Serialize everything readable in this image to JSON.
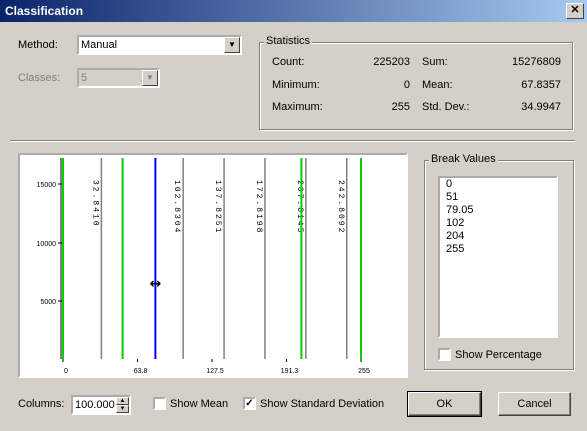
{
  "window": {
    "title": "Classification",
    "close_glyph": "✕"
  },
  "method": {
    "label": "Method:",
    "value": "Manual"
  },
  "classes": {
    "label": "Classes:",
    "value": "5"
  },
  "statistics": {
    "title": "Statistics",
    "count_label": "Count:",
    "count": "225203",
    "min_label": "Minimum:",
    "min": "0",
    "max_label": "Maximum:",
    "max": "255",
    "sum_label": "Sum:",
    "sum": "15276809",
    "mean_label": "Mean:",
    "mean": "67.8357",
    "std_label": "Std. Dev.:",
    "std": "34.9947"
  },
  "chart_data": {
    "type": "histogram",
    "y_ticks": [
      "15000",
      "10000",
      "5000"
    ],
    "x_ticks": [
      "0",
      "63.8",
      "127.5",
      "191.3",
      "255"
    ],
    "xlim": [
      0,
      255
    ],
    "gray_lines": [
      {
        "x": 32.841,
        "label": "32.8410"
      },
      {
        "x": 102.8304,
        "label": "102.8304"
      },
      {
        "x": 137.8251,
        "label": "137.8251"
      },
      {
        "x": 172.8198,
        "label": "172.8198"
      },
      {
        "x": 207.8145,
        "label": "207.8145"
      },
      {
        "x": 242.8092,
        "label": "242.8092"
      }
    ],
    "green_lines": [
      0,
      51,
      204,
      255
    ],
    "selected_line": 79.05,
    "colors": {
      "gray": "#808080",
      "green": "#00d000",
      "blue": "#0000ff"
    },
    "cursor_glyph": "↔"
  },
  "break_values": {
    "title": "Break Values",
    "values": [
      "0",
      "51",
      "79.05",
      "102",
      "204",
      "255"
    ]
  },
  "show_percentage": {
    "label": "Show Percentage",
    "checked": false
  },
  "columns": {
    "label": "Columns:",
    "value": "100.000"
  },
  "show_mean": {
    "label": "Show Mean",
    "checked": false
  },
  "show_std": {
    "label": "Show Standard Deviation",
    "checked": true
  },
  "ok_label": "OK",
  "cancel_label": "Cancel"
}
